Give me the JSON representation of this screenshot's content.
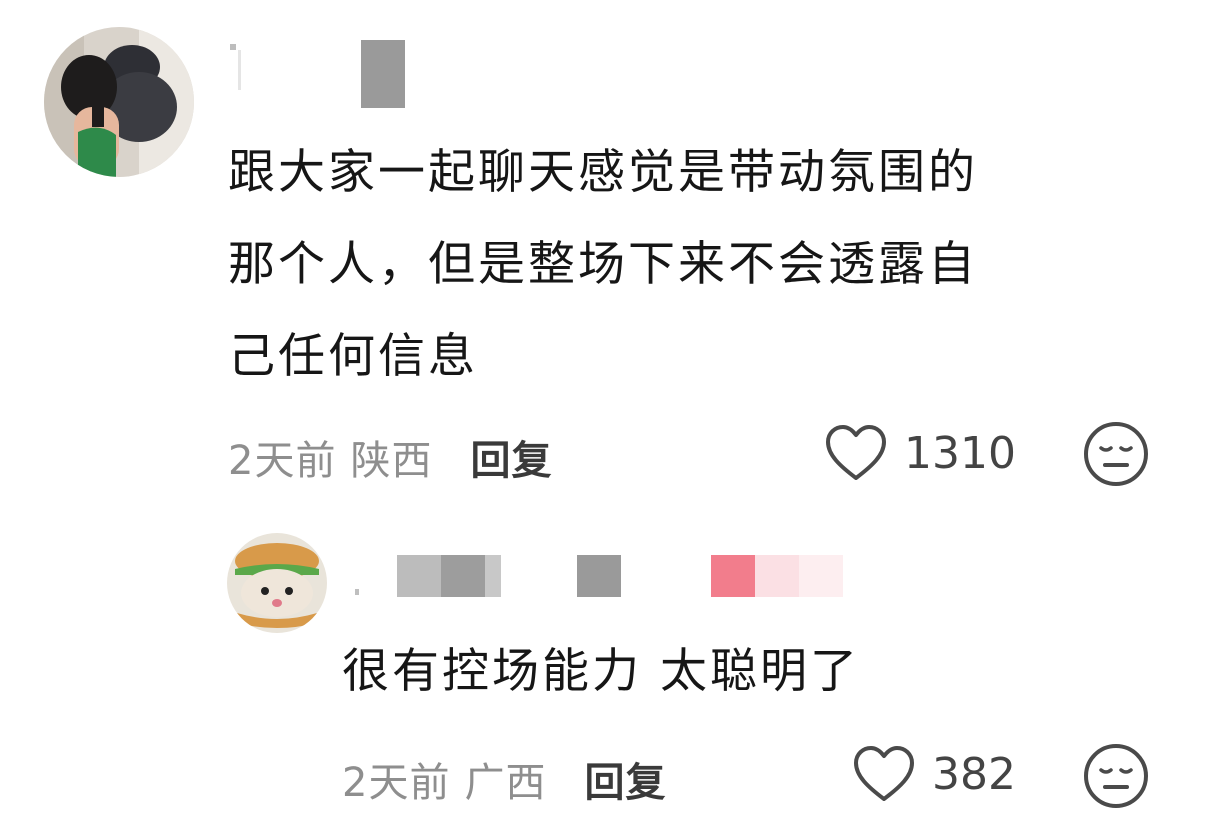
{
  "comments": [
    {
      "text_lines": [
        "跟大家一起聊天感觉是带动氛围的",
        "那个人，但是整场下来不会透露自",
        "己任何信息"
      ],
      "time": "2天前",
      "location": "陕西",
      "reply_label": "回复",
      "likes": "1310",
      "avatar_icon": "woman-with-cat-avatar",
      "dislike_icon": "neutral-face-icon"
    },
    {
      "text_lines": [
        "很有控场能力 太聪明了"
      ],
      "time": "2天前",
      "location": "广西",
      "reply_label": "回复",
      "likes": "382",
      "avatar_icon": "cat-burger-avatar",
      "dislike_icon": "neutral-face-icon"
    }
  ],
  "colors": {
    "text": "#161616",
    "meta": "#8e8e8e",
    "reply": "#3a3a3a",
    "icon": "#4a4a4a"
  }
}
